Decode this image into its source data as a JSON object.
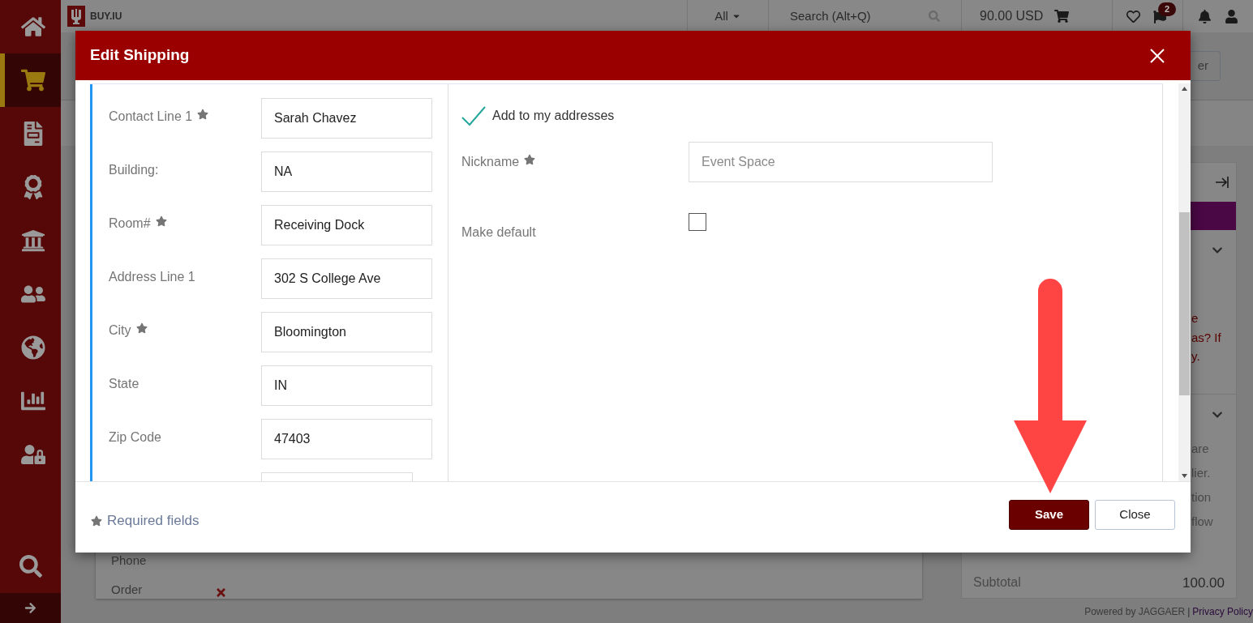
{
  "sidebar": {
    "items": [
      {
        "selected": false
      },
      {
        "selected": true
      },
      {
        "selected": false
      },
      {
        "selected": false
      },
      {
        "selected": false
      },
      {
        "selected": false
      },
      {
        "selected": false
      },
      {
        "selected": false
      },
      {
        "selected": false
      }
    ]
  },
  "top_bar": {
    "logo": "BUY.IU",
    "scope": "All",
    "search": {
      "placeholder": "Search (Alt+Q)"
    },
    "cart_total": "90.00 USD",
    "flag_count": "2"
  },
  "background": {
    "header_button": "er",
    "panel_lines_1": [
      "e",
      "as? If",
      "y."
    ],
    "panel_lines_2": [
      "are",
      "lier.",
      "tion",
      "flow"
    ],
    "subtotal_label": "Subtotal",
    "subtotal_value": "100.00",
    "card_rows": [
      "Phone",
      "Order"
    ],
    "footer": {
      "powered": "Powered by JAGGAER",
      "separator": "|",
      "link": "Privacy Policy"
    }
  },
  "dialog": {
    "title": "Edit Shipping",
    "fields": [
      {
        "label": "Contact Line 1",
        "required": true,
        "value": "Sarah Chavez"
      },
      {
        "label": "Building:",
        "required": false,
        "value": "NA"
      },
      {
        "label": "Room#",
        "required": true,
        "value": "Receiving Dock"
      },
      {
        "label": "Address Line 1",
        "required": false,
        "value": "302 S College Ave"
      },
      {
        "label": "City",
        "required": true,
        "value": "Bloomington"
      },
      {
        "label": "State",
        "required": false,
        "value": "IN"
      },
      {
        "label": "Zip Code",
        "required": false,
        "value": "47403"
      }
    ],
    "add_to_addresses": {
      "label": "Add to my addresses",
      "checked": true
    },
    "nickname": {
      "label": "Nickname",
      "required": true,
      "placeholder": "Event Space"
    },
    "make_default": {
      "label": "Make default",
      "checked": false
    },
    "required_note": "Required fields",
    "buttons": [
      {
        "label": "Save",
        "kind": "primary"
      },
      {
        "label": "Close",
        "kind": "secondary"
      }
    ]
  }
}
